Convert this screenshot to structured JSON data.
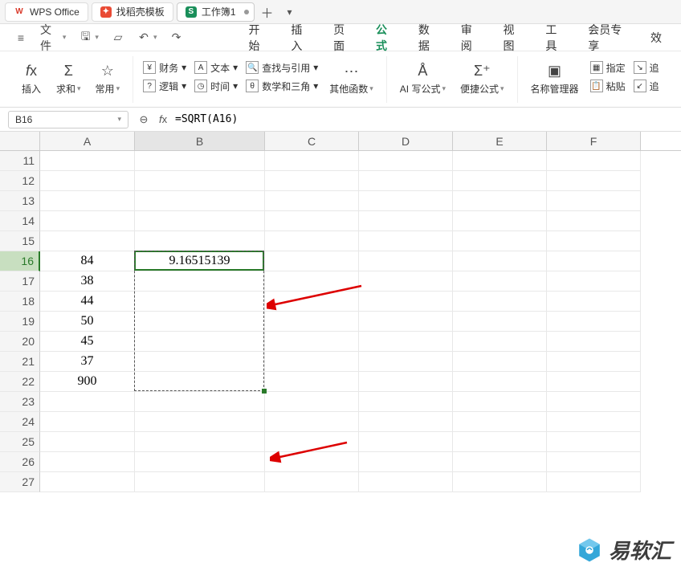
{
  "tabs": {
    "wps": "WPS Office",
    "template": "找稻壳模板",
    "workbook": "工作簿1"
  },
  "menubar": {
    "file": "文件",
    "items": [
      "开始",
      "插入",
      "页面",
      "公式",
      "数据",
      "审阅",
      "视图",
      "工具",
      "会员专享",
      "效"
    ],
    "activeIndex": 3
  },
  "ribbon": {
    "insert": "插入",
    "sum": "求和",
    "common": "常用",
    "finance": "财务",
    "text": "文本",
    "lookup": "查找与引用",
    "logic": "逻辑",
    "datetime": "时间",
    "mathtrig": "数学和三角",
    "other": "其他函数",
    "ai": "AI 写公式",
    "quick": "便捷公式",
    "nameMgr": "名称管理器",
    "paste": "粘贴",
    "define": "指定",
    "trace": "追"
  },
  "namebox": {
    "ref": "B16"
  },
  "formula": {
    "text": "=SQRT(A16)"
  },
  "columns": [
    "A",
    "B",
    "C",
    "D",
    "E",
    "F"
  ],
  "rows": [
    11,
    12,
    13,
    14,
    15,
    16,
    17,
    18,
    19,
    20,
    21,
    22,
    23,
    24,
    25,
    26,
    27
  ],
  "cells": {
    "A16": "84",
    "A17": "38",
    "A18": "44",
    "A19": "50",
    "A20": "45",
    "A21": "37",
    "A22": "900",
    "B16": "9.16515139"
  },
  "selection": {
    "activeRow": 16,
    "activeCol": "B",
    "fillStart": 16,
    "fillEnd": 22
  },
  "watermark": "易软汇"
}
